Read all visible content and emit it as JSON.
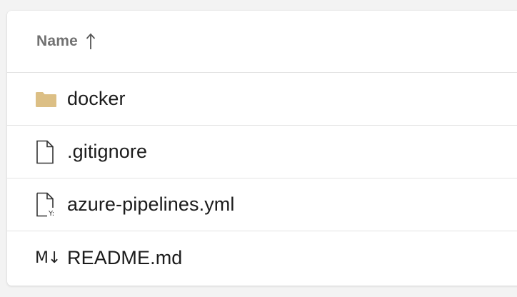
{
  "header": {
    "name_label": "Name",
    "sort_icon": "arrow-up-icon"
  },
  "files": [
    {
      "label": "docker",
      "icon": "folder-icon",
      "icon_color": "#dcbf85"
    },
    {
      "label": ".gitignore",
      "icon": "file-icon"
    },
    {
      "label": "azure-pipelines.yml",
      "icon": "yaml-file-icon",
      "icon_badge": "Y:"
    },
    {
      "label": "README.md",
      "icon": "markdown-icon",
      "icon_text": "M↓"
    }
  ]
}
